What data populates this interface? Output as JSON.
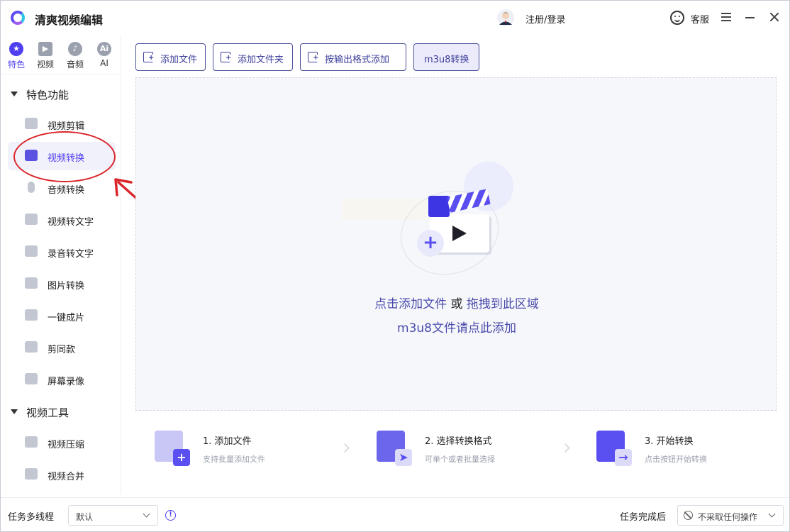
{
  "app": {
    "title": "清爽视频编辑"
  },
  "header": {
    "login_label": "注册/登录",
    "support_label": "客服"
  },
  "categories": [
    {
      "label": "特色",
      "icon": "star-icon",
      "active": true
    },
    {
      "label": "视频",
      "icon": "video-icon"
    },
    {
      "label": "音频",
      "icon": "audio-icon"
    },
    {
      "label": "AI",
      "icon": "ai-icon"
    }
  ],
  "sections": [
    {
      "title": "特色功能",
      "items": [
        {
          "label": "视频剪辑",
          "icon": "film-reel-icon"
        },
        {
          "label": "视频转换",
          "icon": "video-convert-icon",
          "active": true
        },
        {
          "label": "音频转换",
          "icon": "microphone-icon"
        },
        {
          "label": "视频转文字",
          "icon": "video-to-text-icon"
        },
        {
          "label": "录音转文字",
          "icon": "audio-to-text-icon"
        },
        {
          "label": "图片转换",
          "icon": "image-convert-icon"
        },
        {
          "label": "一键成片",
          "icon": "one-click-video-icon"
        },
        {
          "label": "剪同款",
          "icon": "template-icon"
        },
        {
          "label": "屏幕录像",
          "icon": "screen-record-icon"
        }
      ]
    },
    {
      "title": "视频工具",
      "items": [
        {
          "label": "视频压缩",
          "icon": "video-compress-icon"
        },
        {
          "label": "视频合并",
          "icon": "video-merge-icon"
        }
      ]
    }
  ],
  "toolbar": {
    "add_file": "添加文件",
    "add_folder": "添加文件夹",
    "add_by_format": "按输出格式添加",
    "m3u8": "m3u8转换"
  },
  "dropzone": {
    "click_add": "点击添加文件",
    "or": "或",
    "drag_here": "拖拽到此区域",
    "m3u8_hint": "m3u8文件请点此添加"
  },
  "steps": [
    {
      "title": "1. 添加文件",
      "desc": "支持批量添加文件"
    },
    {
      "title": "2. 选择转换格式",
      "desc": "可单个或者批量选择"
    },
    {
      "title": "3. 开始转换",
      "desc": "点击按钮开始转换"
    }
  ],
  "bottom": {
    "multithread_label": "任务多线程",
    "multithread_value": "默认",
    "after_label": "任务完成后",
    "after_value": "不采取任何操作"
  },
  "colors": {
    "accent": "#4f3ff0",
    "annotation": "#d9262b"
  }
}
